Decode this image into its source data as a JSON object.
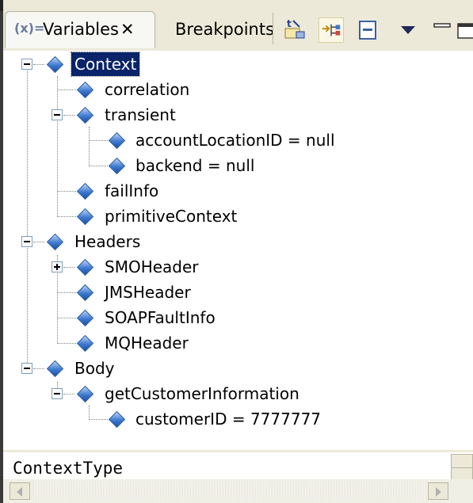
{
  "tabs": {
    "active": {
      "label": "Variables",
      "icon": "variables-icon"
    },
    "inactive": {
      "label": "Breakpoints"
    }
  },
  "toolbar": {
    "icons": [
      "show-type-names-icon",
      "show-logical-structure-icon",
      "collapse-all-icon",
      "view-menu-icon",
      "minimize-icon",
      "maximize-icon"
    ]
  },
  "tree": {
    "context": "Context",
    "correlation": "correlation",
    "transient": "transient",
    "account_location": "accountLocationID = null",
    "backend": "backend = null",
    "fail_info": "failInfo",
    "primitive_context": "primitiveContext",
    "headers": "Headers",
    "smo_header": "SMOHeader",
    "jms_header": "JMSHeader",
    "soap_fault": "SOAPFaultInfo",
    "mq_header": "MQHeader",
    "body": "Body",
    "get_customer": "getCustomerInformation",
    "customer_id": "customerID = 7777777"
  },
  "detail": {
    "text": "ContextType"
  },
  "colors": {
    "selection": "#0a246a",
    "chrome": "#ece9d8",
    "node_icon": "#3e7ad0"
  }
}
